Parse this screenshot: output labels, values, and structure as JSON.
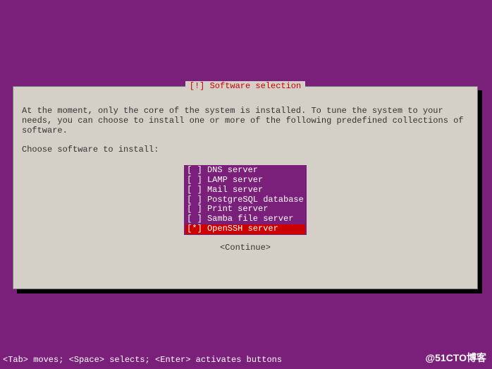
{
  "dialog": {
    "title": "[!] Software selection",
    "intro": "At the moment, only the core of the system is installed. To tune the system to your needs, you can choose to install one or more of the following predefined collections of software.",
    "choose": "Choose software to install:",
    "items": [
      {
        "label": "DNS server",
        "checked": false,
        "highlight": false
      },
      {
        "label": "LAMP server",
        "checked": false,
        "highlight": false
      },
      {
        "label": "Mail server",
        "checked": false,
        "highlight": false
      },
      {
        "label": "PostgreSQL database",
        "checked": false,
        "highlight": false
      },
      {
        "label": "Print server",
        "checked": false,
        "highlight": false
      },
      {
        "label": "Samba file server",
        "checked": false,
        "highlight": false
      },
      {
        "label": "OpenSSH server",
        "checked": true,
        "highlight": true
      }
    ],
    "continue": "<Continue>"
  },
  "help_line": "<Tab> moves; <Space> selects; <Enter> activates buttons",
  "watermark": "@51CTO博客"
}
